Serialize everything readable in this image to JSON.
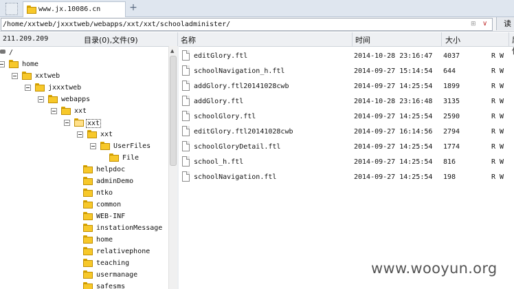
{
  "tab": {
    "title": "www.jx.10086.cn",
    "new_tab_symbol": "+"
  },
  "address": {
    "path": "/home/xxtweb/jxxxtweb/webapps/xxt/xxt/schooladminister/",
    "read_button": "读"
  },
  "header": {
    "ip": "211.209.209",
    "summary": "目录(0),文件(9)",
    "col_name": "名称",
    "col_time": "时间",
    "col_size": "大小",
    "col_attr": "属性"
  },
  "tree": [
    {
      "label": "/",
      "level": 0,
      "toggle": false,
      "folder": false
    },
    {
      "label": "home",
      "level": 0,
      "toggle": true,
      "folder": true
    },
    {
      "label": "xxtweb",
      "level": 1,
      "toggle": true,
      "folder": true
    },
    {
      "label": "jxxxtweb",
      "level": 2,
      "toggle": true,
      "folder": true
    },
    {
      "label": "webapps",
      "level": 3,
      "toggle": true,
      "folder": true
    },
    {
      "label": "xxt",
      "level": 4,
      "toggle": true,
      "folder": true
    },
    {
      "label": "xxt",
      "level": 5,
      "toggle": true,
      "folder": true,
      "selected": true,
      "open": true
    },
    {
      "label": "xxt",
      "level": 6,
      "toggle": true,
      "folder": true
    },
    {
      "label": "UserFiles",
      "level": 7,
      "toggle": true,
      "folder": true
    },
    {
      "label": "File",
      "level": 8,
      "toggle": false,
      "folder": true
    },
    {
      "label": "helpdoc",
      "level": 6,
      "toggle": false,
      "folder": true
    },
    {
      "label": "adminDemo",
      "level": 6,
      "toggle": false,
      "folder": true
    },
    {
      "label": "ntko",
      "level": 6,
      "toggle": false,
      "folder": true
    },
    {
      "label": "common",
      "level": 6,
      "toggle": false,
      "folder": true
    },
    {
      "label": "WEB-INF",
      "level": 6,
      "toggle": false,
      "folder": true
    },
    {
      "label": "instationMessage",
      "level": 6,
      "toggle": false,
      "folder": true
    },
    {
      "label": "home",
      "level": 6,
      "toggle": false,
      "folder": true
    },
    {
      "label": "relativephone",
      "level": 6,
      "toggle": false,
      "folder": true
    },
    {
      "label": "teaching",
      "level": 6,
      "toggle": false,
      "folder": true
    },
    {
      "label": "usermanage",
      "level": 6,
      "toggle": false,
      "folder": true
    },
    {
      "label": "safesms",
      "level": 6,
      "toggle": false,
      "folder": true
    }
  ],
  "files": [
    {
      "name": "editGlory.ftl",
      "time": "2014-10-28 23:16:47",
      "size": "4037",
      "attr": "R W"
    },
    {
      "name": "schoolNavigation_h.ftl",
      "time": "2014-09-27 15:14:54",
      "size": "644",
      "attr": "R W"
    },
    {
      "name": "addGlory.ftl20141028cwb",
      "time": "2014-09-27 14:25:54",
      "size": "1899",
      "attr": "R W"
    },
    {
      "name": "addGlory.ftl",
      "time": "2014-10-28 23:16:48",
      "size": "3135",
      "attr": "R W"
    },
    {
      "name": "schoolGlory.ftl",
      "time": "2014-09-27 14:25:54",
      "size": "2590",
      "attr": "R W"
    },
    {
      "name": "editGlory.ftl20141028cwb",
      "time": "2014-09-27 16:14:56",
      "size": "2794",
      "attr": "R W"
    },
    {
      "name": "schoolGloryDetail.ftl",
      "time": "2014-09-27 14:25:54",
      "size": "1774",
      "attr": "R W"
    },
    {
      "name": "school_h.ftl",
      "time": "2014-09-27 14:25:54",
      "size": "816",
      "attr": "R W"
    },
    {
      "name": "schoolNavigation.ftl",
      "time": "2014-09-27 14:25:54",
      "size": "198",
      "attr": "R W"
    }
  ],
  "watermark": "www.wooyun.org",
  "icons": {
    "tab": "folder-icon",
    "file": "file-icon",
    "tree": "folder-icon",
    "root": "root-drive-icon"
  }
}
